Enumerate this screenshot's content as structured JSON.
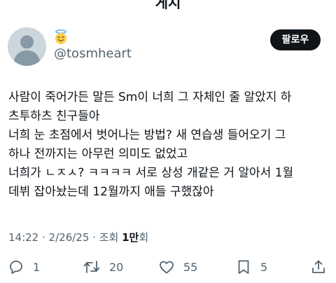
{
  "header": {
    "title": "게시"
  },
  "author": {
    "handle": "@tosmheart",
    "badge_icon": "smiling-face-with-halo-icon"
  },
  "follow_button": {
    "label": "팔로우"
  },
  "tweet": {
    "lines": [
      "사람이 죽어가든 말든 Sm이 너희 그 자체인 줄 알았지 하",
      "츠투하츠 친구들아",
      "너희 눈 초점에서 벗어나는 방법? 새 연습생 들어오기 그",
      "하나 전까지는 아무런 의미도 없었고",
      "너희가 ㄴㅈㅅ? ㅋㅋㅋㅋ 서로 상성 개같은 거 알아서 1월",
      "데뷔 잡아놨는데 12월까지 애들 구했잖아"
    ]
  },
  "meta": {
    "time": "14:22",
    "separator1": " · ",
    "date": "2/26/25",
    "separator2": " · ",
    "views_label": "조회 ",
    "views_count": "1만",
    "views_suffix": "회"
  },
  "actions": {
    "reply_count": "1",
    "retweet_count": "20",
    "like_count": "55",
    "bookmark_count": "5"
  },
  "colors": {
    "text": "#0f1419",
    "secondary": "#536471",
    "button_bg": "#0f1419"
  }
}
